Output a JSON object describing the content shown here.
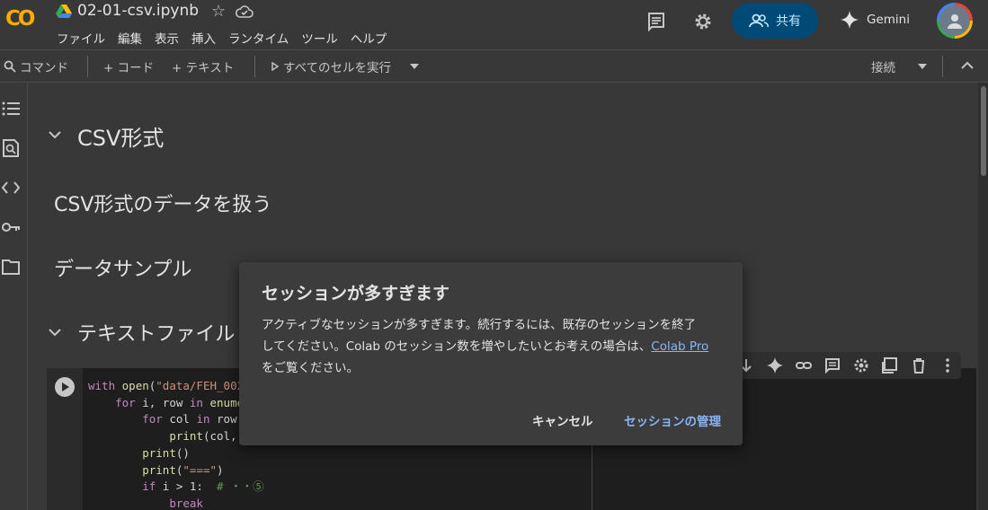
{
  "header": {
    "title": "02-01-csv.ipynb",
    "menu": [
      "ファイル",
      "編集",
      "表示",
      "挿入",
      "ランタイム",
      "ツール",
      "ヘルプ"
    ],
    "share_label": "共有",
    "gemini_label": "Gemini",
    "logo_text": "CO"
  },
  "toolbar": {
    "command_label": "コマンド",
    "code_label": "+ コード",
    "text_label": "+ テキスト",
    "run_all_label": "すべてのセルを実行",
    "connect_label": "接続"
  },
  "notebook": {
    "headings": [
      "CSV形式",
      "CSV形式のデータを扱う",
      "データサンプル",
      "テキストファイル"
    ],
    "code_lines": [
      "with open(\"data/FEH_0020",
      "    for i, row in enumer",
      "        for col in row.s",
      "            print(col, e",
      "        print()",
      "        print(\"===\")",
      "        if i > 1:  # ・・⑤",
      "            break"
    ]
  },
  "dialog": {
    "title": "セッションが多すぎます",
    "body_line1": "アクティブなセッションが多すぎます。続行するには、既存のセッションを終了",
    "body_line2_pre": "してください。Colab のセッション数を増やしたいとお考えの場合は、",
    "body_link": "Colab Pro",
    "body_line3": "をご覧ください。",
    "cancel_label": "キャンセル",
    "manage_label": "セッションの管理"
  },
  "colors": {
    "accent_link": "#8ab4f8",
    "share_bg": "#004a77",
    "logo_orange": "#f9ab00"
  }
}
